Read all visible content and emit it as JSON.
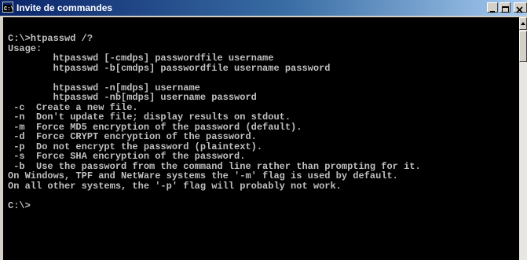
{
  "window": {
    "title": "Invite de commandes",
    "icon": "cmd-icon",
    "controls": [
      "minimize-icon",
      "maximize-icon",
      "close-icon"
    ]
  },
  "colors": {
    "titlebar": "#0a246a",
    "console_bg": "#000000",
    "console_text": "#c0c0c0",
    "window_frame": "#d4d0c8"
  },
  "console": {
    "lines": [
      "C:\\>htpasswd /?",
      "Usage:",
      "        htpasswd [-cmdps] passwordfile username",
      "        htpasswd -b[cmdps] passwordfile username password",
      "",
      "        htpasswd -n[mdps] username",
      "        htpasswd -nb[mdps] username password",
      " -c  Create a new file.",
      " -n  Don't update file; display results on stdout.",
      " -m  Force MD5 encryption of the password (default).",
      " -d  Force CRYPT encryption of the password.",
      " -p  Do not encrypt the password (plaintext).",
      " -s  Force SHA encryption of the password.",
      " -b  Use the password from the command line rather than prompting for it.",
      "On Windows, TPF and NetWare systems the '-m' flag is used by default.",
      "On all other systems, the '-p' flag will probably not work.",
      "",
      "C:\\>"
    ]
  }
}
